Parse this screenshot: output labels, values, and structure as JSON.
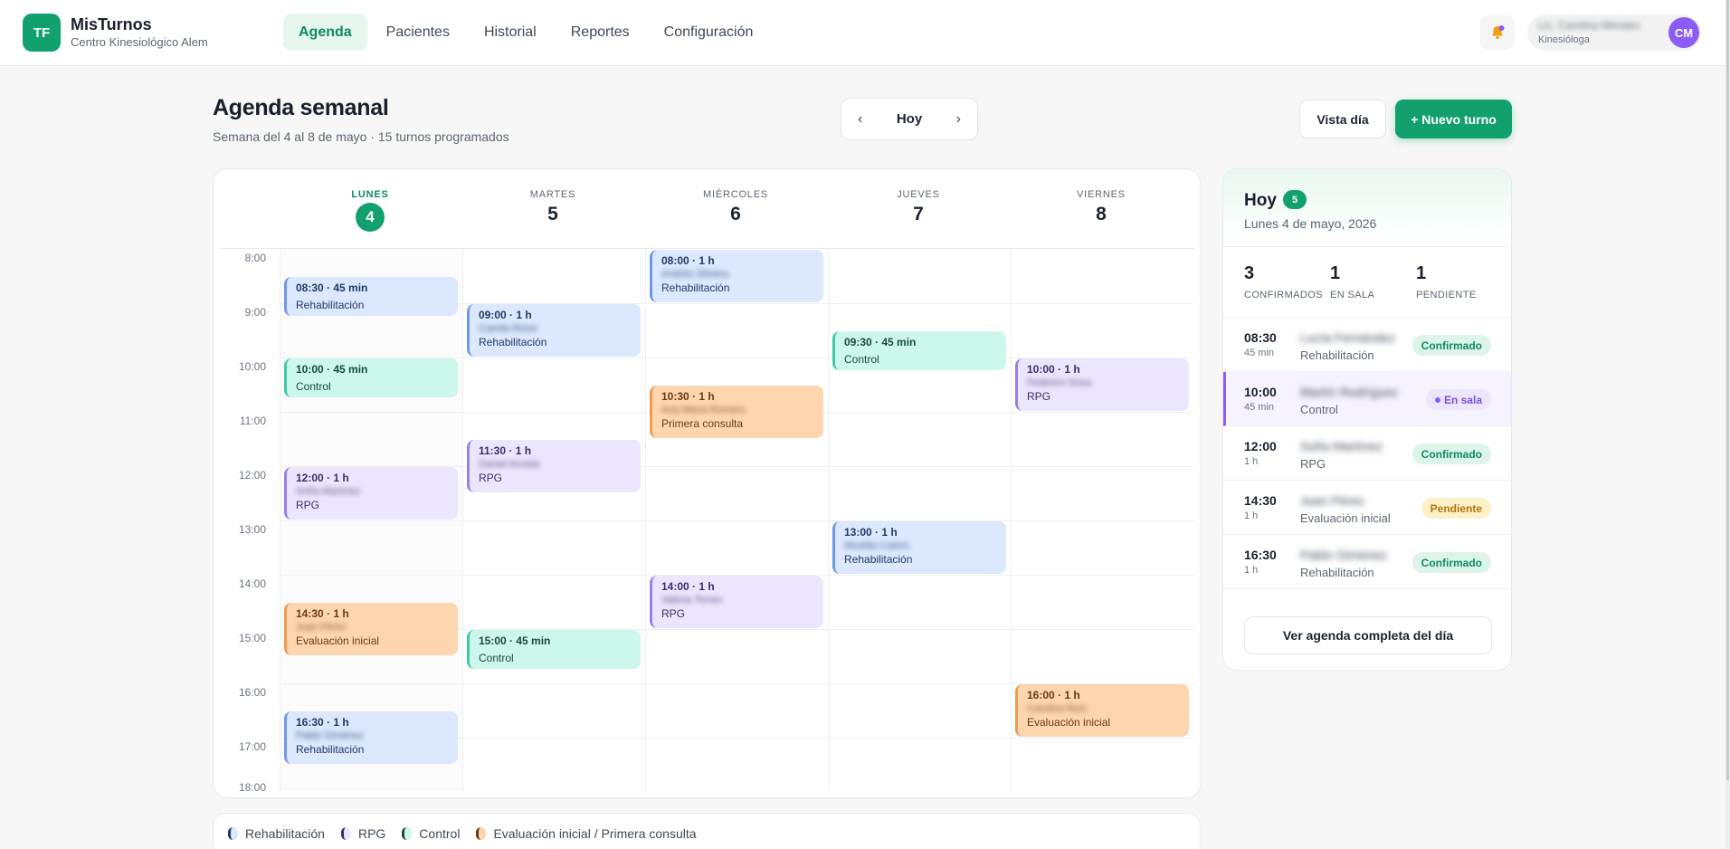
{
  "header": {
    "logo_initials": "TF",
    "app_name": "MisTurnos",
    "clinic_name": "Centro Kinesiológico Alem",
    "nav": [
      "Agenda",
      "Pacientes",
      "Historial",
      "Reportes",
      "Configuración"
    ],
    "active_nav": "Agenda",
    "user_name": "Lic. Carolina Méndez",
    "user_role": "Kinesióloga",
    "user_initials": "CM"
  },
  "page": {
    "title": "Agenda semanal",
    "subtitle": "Semana del 4 al 8 de mayo · 15 turnos programados",
    "prev": "‹",
    "today_button": "Hoy",
    "next": "›",
    "view_day_button": "Vista día",
    "new_button": "+ Nuevo turno"
  },
  "calendar": {
    "days": [
      {
        "name": "LUNES",
        "num": "4",
        "today": true
      },
      {
        "name": "MARTES",
        "num": "5"
      },
      {
        "name": "MIÉRCOLES",
        "num": "6"
      },
      {
        "name": "JUEVES",
        "num": "7"
      },
      {
        "name": "VIERNES",
        "num": "8"
      }
    ],
    "hours": [
      "8:00",
      "9:00",
      "10:00",
      "11:00",
      "12:00",
      "13:00",
      "14:00",
      "15:00",
      "16:00",
      "17:00",
      "18:00"
    ],
    "appointments": [
      {
        "day": 0,
        "start": 8.5,
        "duration": 0.75,
        "label": "08:30 · 45 min",
        "patient": "Lucía Fernández",
        "kind": "Rehabilitación",
        "type": "reh"
      },
      {
        "day": 0,
        "start": 10,
        "duration": 0.75,
        "label": "10:00 · 45 min",
        "patient": "Martín Rodríguez",
        "kind": "Control",
        "type": "ctl"
      },
      {
        "day": 0,
        "start": 12,
        "duration": 1,
        "label": "12:00 · 1 h",
        "patient": "Sofía Martínez",
        "kind": "RPG",
        "type": "rpg"
      },
      {
        "day": 0,
        "start": 14.5,
        "duration": 1,
        "label": "14:30 · 1 h",
        "patient": "Juan Pérez",
        "kind": "Evaluación inicial",
        "type": "eval"
      },
      {
        "day": 0,
        "start": 16.5,
        "duration": 1,
        "label": "16:30 · 1 h",
        "patient": "Pablo Giménez",
        "kind": "Rehabilitación",
        "type": "reh"
      },
      {
        "day": 1,
        "start": 9,
        "duration": 1,
        "label": "09:00 · 1 h",
        "patient": "Camila Rossi",
        "kind": "Rehabilitación",
        "type": "reh"
      },
      {
        "day": 1,
        "start": 11.5,
        "duration": 1,
        "label": "11:30 · 1 h",
        "patient": "Daniel Acosta",
        "kind": "RPG",
        "type": "rpg"
      },
      {
        "day": 1,
        "start": 15,
        "duration": 0.75,
        "label": "15:00 · 45 min",
        "patient": "",
        "kind": "Control",
        "type": "ctl"
      },
      {
        "day": 2,
        "start": 8,
        "duration": 1,
        "label": "08:00 · 1 h",
        "patient": "Andrés Silveira",
        "kind": "Rehabilitación",
        "type": "reh"
      },
      {
        "day": 2,
        "start": 10.5,
        "duration": 1,
        "label": "10:30 · 1 h",
        "patient": "Ana María Romero",
        "kind": "Primera consulta",
        "type": "eval"
      },
      {
        "day": 2,
        "start": 14,
        "duration": 1,
        "label": "14:00 · 1 h",
        "patient": "Valeria Torres",
        "kind": "RPG",
        "type": "rpg"
      },
      {
        "day": 3,
        "start": 9.5,
        "duration": 0.75,
        "label": "09:30 · 45 min",
        "patient": "",
        "kind": "Control",
        "type": "ctl"
      },
      {
        "day": 3,
        "start": 13,
        "duration": 1,
        "label": "13:00 · 1 h",
        "patient": "Nicolás Castro",
        "kind": "Rehabilitación",
        "type": "reh"
      },
      {
        "day": 4,
        "start": 10,
        "duration": 1,
        "label": "10:00 · 1 h",
        "patient": "Federico Sosa",
        "kind": "RPG",
        "type": "rpg"
      },
      {
        "day": 4,
        "start": 16,
        "duration": 1,
        "label": "16:00 · 1 h",
        "patient": "Carolina Ruiz",
        "kind": "Evaluación inicial",
        "type": "eval"
      }
    ]
  },
  "legend": [
    {
      "label": "Rehabilitación",
      "type": "reh"
    },
    {
      "label": "RPG",
      "type": "rpg"
    },
    {
      "label": "Control",
      "type": "ctl"
    },
    {
      "label": "Evaluación inicial / Primera consulta",
      "type": "eval"
    }
  ],
  "today_panel": {
    "title": "Hoy",
    "count": "5",
    "date": "Lunes 4 de mayo, 2026",
    "stats": [
      {
        "value": "3",
        "label": "CONFIRMADOS"
      },
      {
        "value": "1",
        "label": "EN SALA"
      },
      {
        "value": "1",
        "label": "PENDIENTE"
      }
    ],
    "rows": [
      {
        "time": "08:30",
        "duration": "45 min",
        "patient": "Lucía Fernández",
        "kind": "Rehabilitación",
        "status": "Confirmado",
        "status_type": "conf"
      },
      {
        "time": "10:00",
        "duration": "45 min",
        "patient": "Martín Rodríguez",
        "kind": "Control",
        "status": "En sala",
        "status_type": "sala",
        "active": true
      },
      {
        "time": "12:00",
        "duration": "1 h",
        "patient": "Sofía Martínez",
        "kind": "RPG",
        "status": "Confirmado",
        "status_type": "conf"
      },
      {
        "time": "14:30",
        "duration": "1 h",
        "patient": "Juan Pérez",
        "kind": "Evaluación inicial",
        "status": "Pendiente",
        "status_type": "pend"
      },
      {
        "time": "16:30",
        "duration": "1 h",
        "patient": "Pablo Giménez",
        "kind": "Rehabilitación",
        "status": "Confirmado",
        "status_type": "conf"
      }
    ],
    "full_button": "Ver agenda completa del día"
  },
  "colors": {
    "brand": "#12a06e",
    "rehabilitacion": "#dbe8fd",
    "control": "#cdf7ec",
    "rpg": "#ebe6fd",
    "evaluacion": "#fdd5ae"
  }
}
